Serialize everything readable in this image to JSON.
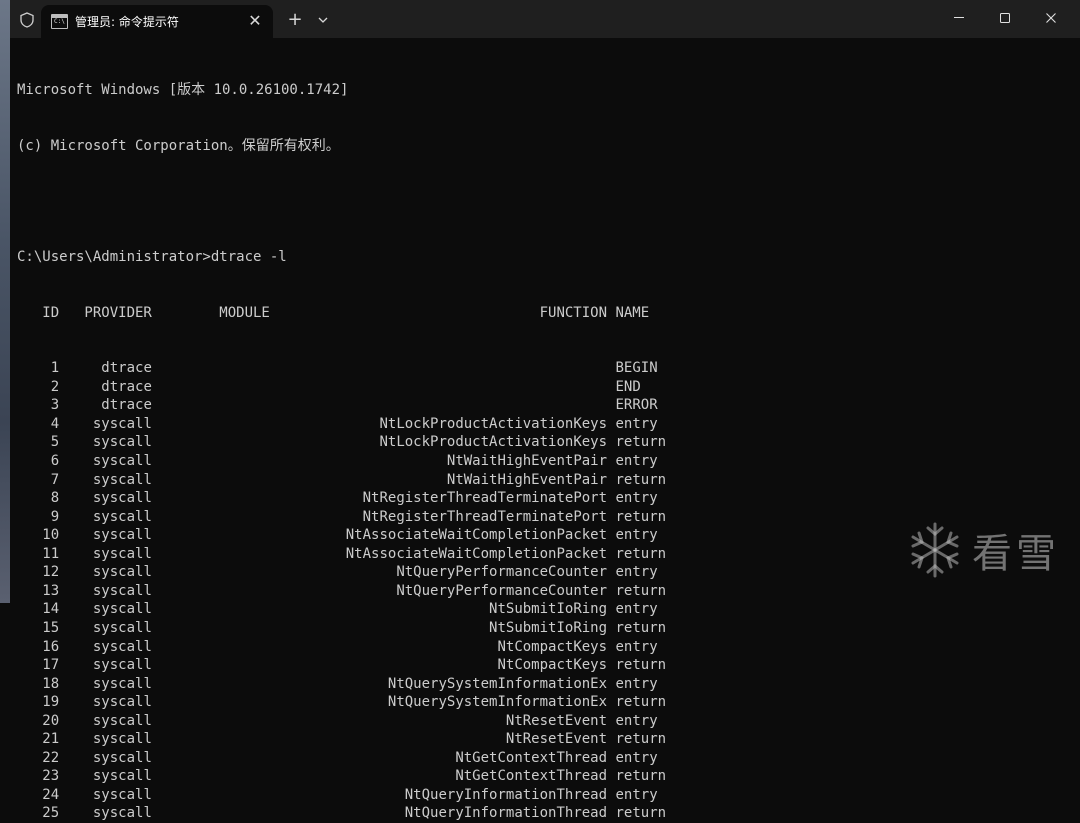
{
  "window": {
    "tab_title": "管理员: 命令提示符",
    "tab_icon_text": "C:\\",
    "close_tab_label": "✕",
    "new_tab_label": "+"
  },
  "console": {
    "banner_line1": "Microsoft Windows [版本 10.0.26100.1742]",
    "banner_line2": "(c) Microsoft Corporation。保留所有权利。",
    "prompt": "C:\\Users\\Administrator>",
    "command": "dtrace -l",
    "columns": [
      "ID",
      "PROVIDER",
      "MODULE",
      "FUNCTION",
      "NAME"
    ],
    "rows": [
      {
        "id": "1",
        "provider": "dtrace",
        "module": "",
        "function": "",
        "name": "BEGIN"
      },
      {
        "id": "2",
        "provider": "dtrace",
        "module": "",
        "function": "",
        "name": "END"
      },
      {
        "id": "3",
        "provider": "dtrace",
        "module": "",
        "function": "",
        "name": "ERROR"
      },
      {
        "id": "4",
        "provider": "syscall",
        "module": "",
        "function": "NtLockProductActivationKeys",
        "name": "entry"
      },
      {
        "id": "5",
        "provider": "syscall",
        "module": "",
        "function": "NtLockProductActivationKeys",
        "name": "return"
      },
      {
        "id": "6",
        "provider": "syscall",
        "module": "",
        "function": "NtWaitHighEventPair",
        "name": "entry"
      },
      {
        "id": "7",
        "provider": "syscall",
        "module": "",
        "function": "NtWaitHighEventPair",
        "name": "return"
      },
      {
        "id": "8",
        "provider": "syscall",
        "module": "",
        "function": "NtRegisterThreadTerminatePort",
        "name": "entry"
      },
      {
        "id": "9",
        "provider": "syscall",
        "module": "",
        "function": "NtRegisterThreadTerminatePort",
        "name": "return"
      },
      {
        "id": "10",
        "provider": "syscall",
        "module": "",
        "function": "NtAssociateWaitCompletionPacket",
        "name": "entry"
      },
      {
        "id": "11",
        "provider": "syscall",
        "module": "",
        "function": "NtAssociateWaitCompletionPacket",
        "name": "return"
      },
      {
        "id": "12",
        "provider": "syscall",
        "module": "",
        "function": "NtQueryPerformanceCounter",
        "name": "entry"
      },
      {
        "id": "13",
        "provider": "syscall",
        "module": "",
        "function": "NtQueryPerformanceCounter",
        "name": "return"
      },
      {
        "id": "14",
        "provider": "syscall",
        "module": "",
        "function": "NtSubmitIoRing",
        "name": "entry"
      },
      {
        "id": "15",
        "provider": "syscall",
        "module": "",
        "function": "NtSubmitIoRing",
        "name": "return"
      },
      {
        "id": "16",
        "provider": "syscall",
        "module": "",
        "function": "NtCompactKeys",
        "name": "entry"
      },
      {
        "id": "17",
        "provider": "syscall",
        "module": "",
        "function": "NtCompactKeys",
        "name": "return"
      },
      {
        "id": "18",
        "provider": "syscall",
        "module": "",
        "function": "NtQuerySystemInformationEx",
        "name": "entry"
      },
      {
        "id": "19",
        "provider": "syscall",
        "module": "",
        "function": "NtQuerySystemInformationEx",
        "name": "return"
      },
      {
        "id": "20",
        "provider": "syscall",
        "module": "",
        "function": "NtResetEvent",
        "name": "entry"
      },
      {
        "id": "21",
        "provider": "syscall",
        "module": "",
        "function": "NtResetEvent",
        "name": "return"
      },
      {
        "id": "22",
        "provider": "syscall",
        "module": "",
        "function": "NtGetContextThread",
        "name": "entry"
      },
      {
        "id": "23",
        "provider": "syscall",
        "module": "",
        "function": "NtGetContextThread",
        "name": "return"
      },
      {
        "id": "24",
        "provider": "syscall",
        "module": "",
        "function": "NtQueryInformationThread",
        "name": "entry"
      },
      {
        "id": "25",
        "provider": "syscall",
        "module": "",
        "function": "NtQueryInformationThread",
        "name": "return"
      }
    ]
  },
  "watermark": {
    "text": "看雪"
  },
  "colors": {
    "terminal_bg": "#0c0c0c",
    "titlebar_bg": "#1f1f1f",
    "text": "#cccccc"
  },
  "icons": {
    "shield": "shield-icon",
    "dropdown": "chevron-down-icon",
    "minimize": "minimize-icon",
    "maximize": "maximize-icon",
    "close": "close-icon",
    "watermark": "snowflake-icon"
  }
}
